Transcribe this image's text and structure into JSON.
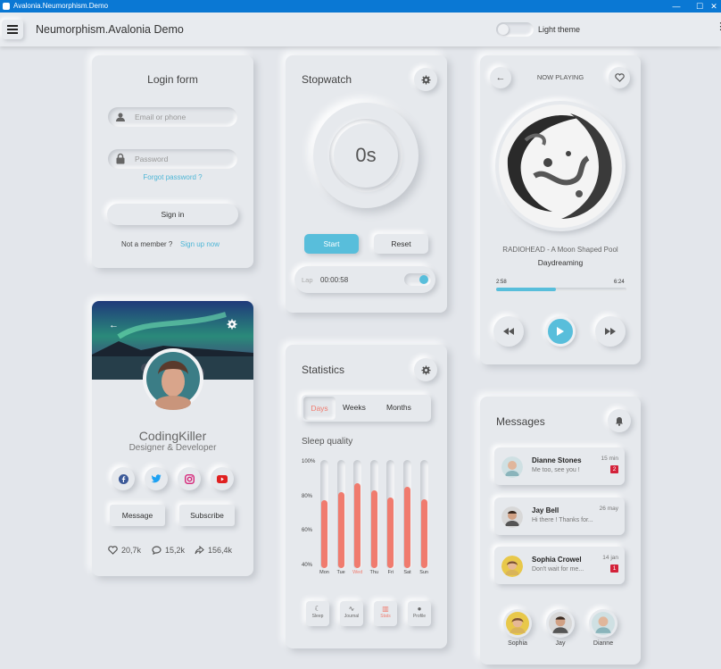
{
  "window": {
    "title": "Avalonia.Neumorphism.Demo",
    "minimize": "—",
    "maximize": "☐",
    "close": "✕"
  },
  "appbar": {
    "title": "Neumorphism.Avalonia Demo",
    "theme_label": "Light theme",
    "menu_glyph": "⋮"
  },
  "login": {
    "title": "Login form",
    "email_placeholder": "Email or phone",
    "password_placeholder": "Password",
    "forgot": "Forgot password ?",
    "signin": "Sign in",
    "not_member": "Not a member ?",
    "signup": "Sign up now"
  },
  "profile": {
    "name": "CodingKiller",
    "role": "Designer & Developer",
    "message": "Message",
    "subscribe": "Subscribe",
    "likes": "20,7k",
    "comments": "15,2k",
    "shares": "156,4k"
  },
  "stopwatch": {
    "title": "Stopwatch",
    "time": "0s",
    "start": "Start",
    "reset": "Reset",
    "lap_label": "Lap",
    "lap_time": "00:00:58"
  },
  "statistics": {
    "title": "Statistics",
    "tabs": [
      "Days",
      "Weeks",
      "Months"
    ],
    "subtitle": "Sleep quality",
    "nav": [
      "Sleep",
      "Journal",
      "Stats",
      "Profile"
    ]
  },
  "chart_data": {
    "type": "bar",
    "title": "Sleep quality",
    "categories": [
      "Mon",
      "Tue",
      "Wed",
      "Thu",
      "Fri",
      "Sat",
      "Sun"
    ],
    "values": [
      77,
      82,
      87,
      83,
      79,
      85,
      78
    ],
    "yticks": [
      "100%",
      "80%",
      "60%",
      "40%"
    ],
    "ylim": [
      40,
      100
    ],
    "highlight": "Wed",
    "bar_color": "#f07b6e"
  },
  "player": {
    "header": "NOW PLAYING",
    "track": "RADIOHEAD - A Moon Shaped Pool",
    "song": "Daydreaming",
    "elapsed": "2:58",
    "total": "6:24",
    "progress": 0.46
  },
  "messages": {
    "title": "Messages",
    "items": [
      {
        "name": "Dianne Stones",
        "text": "Me too, see you !",
        "time": "15 min",
        "badge": "2"
      },
      {
        "name": "Jay Bell",
        "text": "Hi there ! Thanks for...",
        "time": "26 may",
        "badge": ""
      },
      {
        "name": "Sophia Crowel",
        "text": "Don't wait for me...",
        "time": "14 jan",
        "badge": "1"
      }
    ],
    "contacts": [
      "Sophia",
      "Jay",
      "Dianne"
    ]
  },
  "colors": {
    "accent": "#4fb6d6",
    "bar": "#f07b6e",
    "badge": "#d3223a",
    "titlebar": "#0a78d4"
  }
}
